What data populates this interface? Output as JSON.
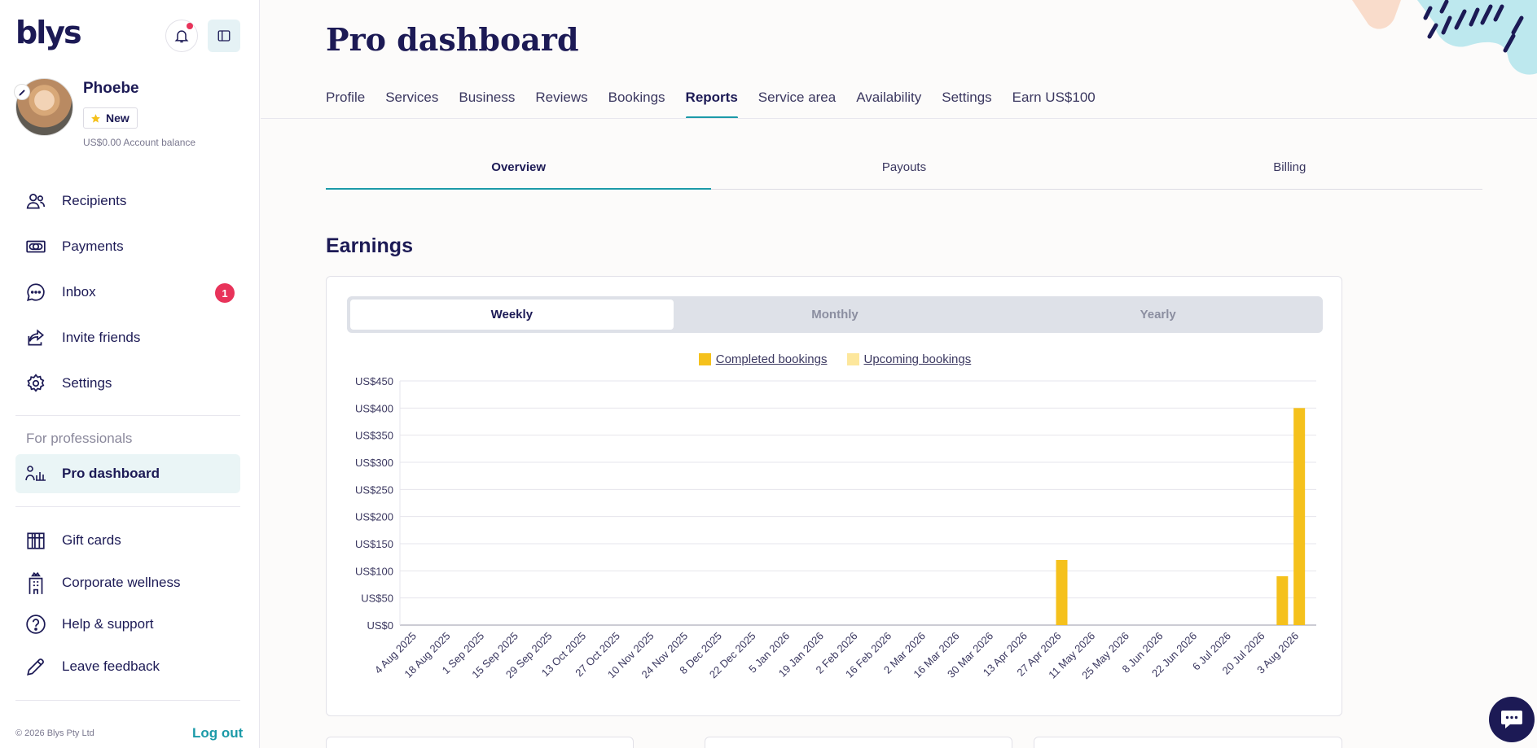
{
  "sidebar": {
    "logo": "blys",
    "user": {
      "name": "Phoebe",
      "badge": "New",
      "balance": "US$0.00",
      "balance_label": "Account balance"
    },
    "nav": [
      {
        "label": "Recipients",
        "icon": "users-icon"
      },
      {
        "label": "Payments",
        "icon": "cash-icon"
      },
      {
        "label": "Inbox",
        "icon": "chat-bubble-icon",
        "count": "1"
      },
      {
        "label": "Invite friends",
        "icon": "share-icon"
      },
      {
        "label": "Settings",
        "icon": "gear-icon"
      }
    ],
    "section_label": "For professionals",
    "pro_dashboard": "Pro dashboard",
    "nav2": [
      {
        "label": "Gift cards",
        "icon": "gift-icon"
      },
      {
        "label": "Corporate wellness",
        "icon": "building-icon"
      },
      {
        "label": "Help & support",
        "icon": "help-icon"
      },
      {
        "label": "Leave feedback",
        "icon": "pencil-icon"
      }
    ],
    "copyright": "© 2026 Blys Pty Ltd",
    "logout": "Log out"
  },
  "header": {
    "title": "Pro dashboard",
    "tabs": [
      "Profile",
      "Services",
      "Business",
      "Reviews",
      "Bookings",
      "Reports",
      "Service area",
      "Availability",
      "Settings",
      "Earn US$100"
    ],
    "active_tab": "Reports"
  },
  "subtabs": {
    "items": [
      "Overview",
      "Payouts",
      "Billing"
    ],
    "active": "Overview"
  },
  "earnings": {
    "title": "Earnings",
    "periods": [
      "Weekly",
      "Monthly",
      "Yearly"
    ],
    "active_period": "Weekly"
  },
  "colors": {
    "accent": "#1b9aa8",
    "completed": "#f5c11c",
    "upcoming": "#fde79c",
    "navy": "#1c1a55"
  },
  "chart_data": {
    "type": "bar",
    "legend": [
      {
        "name": "Completed bookings",
        "color": "#f5c11c"
      },
      {
        "name": "Upcoming bookings",
        "color": "#fde79c"
      }
    ],
    "y_ticks": [
      "US$0",
      "US$50",
      "US$100",
      "US$150",
      "US$200",
      "US$250",
      "US$300",
      "US$350",
      "US$400",
      "US$450"
    ],
    "ylim": [
      0,
      450
    ],
    "x_ticks": [
      "4 Aug 2025",
      "18 Aug 2025",
      "1 Sep 2025",
      "15 Sep 2025",
      "29 Sep 2025",
      "13 Oct 2025",
      "27 Oct 2025",
      "10 Nov 2025",
      "24 Nov 2025",
      "8 Dec 2025",
      "22 Dec 2025",
      "5 Jan 2026",
      "19 Jan 2026",
      "2 Feb 2026",
      "16 Feb 2026",
      "2 Mar 2026",
      "16 Mar 2026",
      "30 Mar 2026",
      "13 Apr 2026",
      "27 Apr 2026",
      "11 May 2026",
      "25 May 2026",
      "8 Jun 2026",
      "22 Jun 2026",
      "6 Jul 2026",
      "20 Jul 2026",
      "3 Aug 2026"
    ],
    "bars": [
      {
        "week": "27 Apr 2026",
        "series": "Completed bookings",
        "value": 120
      },
      {
        "week": "27 Jul 2026",
        "series": "Completed bookings",
        "value": 90
      },
      {
        "week": "3 Aug 2026",
        "series": "Completed bookings",
        "value": 400
      }
    ]
  }
}
